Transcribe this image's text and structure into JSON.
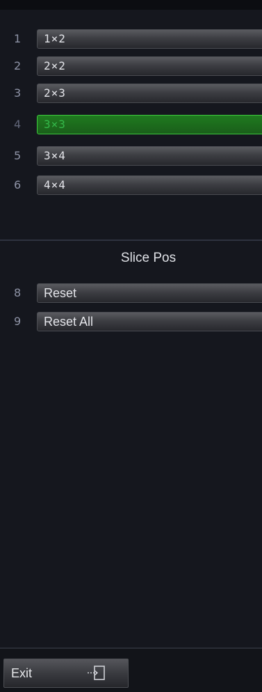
{
  "layouts": [
    {
      "num": "1",
      "label": "1×2",
      "active": false
    },
    {
      "num": "2",
      "label": "2×2",
      "active": false
    },
    {
      "num": "3",
      "label": "2×3",
      "active": false
    },
    {
      "num": "4",
      "label": "3×3",
      "active": true
    },
    {
      "num": "5",
      "label": "3×4",
      "active": false
    },
    {
      "num": "6",
      "label": "4×4",
      "active": false
    }
  ],
  "slice_pos": {
    "title": "Slice Pos",
    "items": [
      {
        "num": "8",
        "label": "Reset"
      },
      {
        "num": "9",
        "label": "Reset All"
      }
    ]
  },
  "footer": {
    "exit_label": "Exit",
    "exit_icon": "exit-door-icon"
  },
  "colors": {
    "background": "#15171e",
    "active_fill": "#1a6a1a",
    "active_text": "#34b84a",
    "button_text": "#e4e5ea",
    "number_text": "#8e93a6"
  }
}
